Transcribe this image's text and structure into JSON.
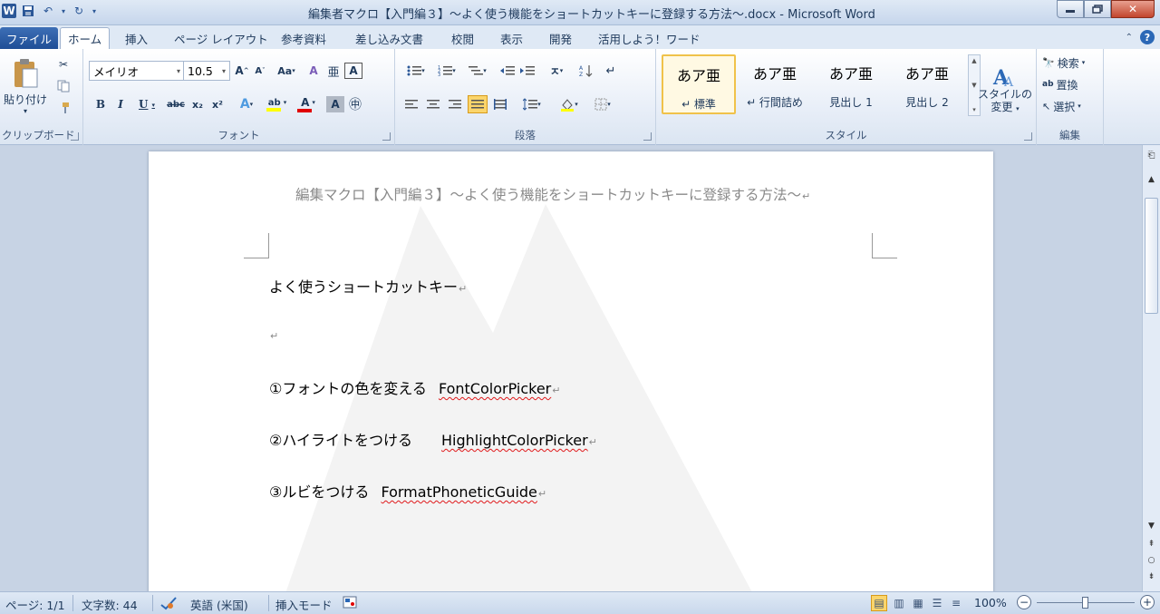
{
  "title_bar": {
    "doc_name_dim": "",
    "title": "編集者マクロ【入門編３】～よく使う機能をショートカットキーに登録する方法～.docx - Microsoft Word",
    "qat_sep": "|"
  },
  "ribbon_tabs": [
    {
      "label": "ファイル"
    },
    {
      "label": "ホーム"
    },
    {
      "label": "挿入"
    },
    {
      "label": "ページ レイアウト"
    },
    {
      "label": "参考資料"
    },
    {
      "label": "差し込み文書"
    },
    {
      "label": "校閲"
    },
    {
      "label": "表示"
    },
    {
      "label": "開発"
    },
    {
      "label": "活用しよう！ワード"
    }
  ],
  "clipboard": {
    "paste_label": "貼り付け",
    "group_label": "クリップボード"
  },
  "font": {
    "font_name": "メイリオ",
    "font_size": "10.5",
    "group_label": "フォント",
    "grow": "A",
    "shrink": "A",
    "case": "Aa",
    "bold": "B",
    "italic": "I",
    "underline": "U",
    "strike": "abc",
    "sub": "x₂",
    "sup": "x²",
    "clear": "A",
    "ruby": "亜",
    "border": "A",
    "effects": "A",
    "highlight": "ab",
    "color": "A",
    "shading": "A",
    "enclose": "㊥"
  },
  "paragraph": {
    "group_label": "段落"
  },
  "styles": {
    "items": [
      {
        "sample": "あア亜",
        "name": "↵ 標準"
      },
      {
        "sample": "あア亜",
        "name": "↵ 行間詰め"
      },
      {
        "sample": "あア亜",
        "name": "見出し 1"
      },
      {
        "sample": "あア亜",
        "name": "見出し 2"
      }
    ],
    "change_label": "スタイルの\n変更",
    "change_label_1": "スタイルの",
    "change_label_2": "変更",
    "group_label": "スタイル"
  },
  "editing": {
    "find": "検索",
    "replace": "置換",
    "select": "選択",
    "group_label": "編集"
  },
  "document": {
    "header": "編集マクロ【入門編３】～よく使う機能をショートカットキーに登録する方法～",
    "heading": "よく使うショートカットキー",
    "items": [
      {
        "jp": "①フォントの色を変える",
        "cmd": "FontColorPicker"
      },
      {
        "jp": "②ハイライトをつける",
        "cmd": "HighlightColorPicker"
      },
      {
        "jp": "③ルビをつける",
        "cmd": "FormatPhoneticGuide"
      }
    ],
    "para_mark": "↵"
  },
  "status_bar": {
    "page": "ページ: 1/1",
    "words": "文字数: 44",
    "language": "英語 (米国)",
    "mode": "挿入モード",
    "zoom": "100%",
    "zoom_value": 100
  },
  "colors": {
    "highlight_bar": "#ffff00",
    "font_color_bar": "#e00000",
    "selected_style_border": "#f0c24a",
    "spellcheck": "#e0191b"
  }
}
